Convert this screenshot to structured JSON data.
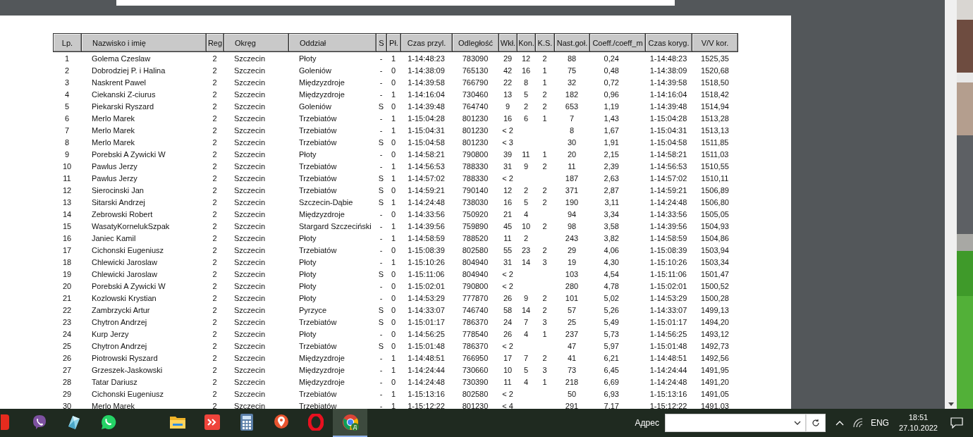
{
  "table": {
    "columns": [
      "Lp.",
      "Nazwisko i imię",
      "Reg",
      "Okręg",
      "Oddział",
      "S",
      "Pł.",
      "Czas przyl.",
      "Odległość",
      "Wkł.",
      "Kon.",
      "K.S.",
      "Nast.goł.",
      "Coeff./coeff_m",
      "Czas koryg.",
      "V/V kor."
    ],
    "rows": [
      [
        "1",
        "Golema Czeslaw",
        "2",
        "Szczecin",
        "Płoty",
        "-",
        "1",
        "1-14:48:23",
        "783090",
        "29",
        "12",
        "2",
        "88",
        "0,24",
        "1-14:48:23",
        "1525,35"
      ],
      [
        "2",
        "Dobrodziej P. i Halina",
        "2",
        "Szczecin",
        "Goleniów",
        "-",
        "0",
        "1-14:38:09",
        "765130",
        "42",
        "16",
        "1",
        "75",
        "0,48",
        "1-14:38:09",
        "1520,68"
      ],
      [
        "3",
        "Naskrent Pawel",
        "2",
        "Szczecin",
        "Międzyzdroje",
        "-",
        "0",
        "1-14:39:58",
        "766790",
        "22",
        "8",
        "1",
        "32",
        "0,72",
        "1-14:39:58",
        "1518,50"
      ],
      [
        "4",
        "Ciekanski Z-ciurus",
        "2",
        "Szczecin",
        "Międzyzdroje",
        "-",
        "1",
        "1-14:16:04",
        "730460",
        "13",
        "5",
        "2",
        "182",
        "0,96",
        "1-14:16:04",
        "1518,42"
      ],
      [
        "5",
        "Piekarski Ryszard",
        "2",
        "Szczecin",
        "Goleniów",
        "S",
        "0",
        "1-14:39:48",
        "764740",
        "9",
        "2",
        "2",
        "653",
        "1,19",
        "1-14:39:48",
        "1514,94"
      ],
      [
        "6",
        "Merlo Marek",
        "2",
        "Szczecin",
        "Trzebiatów",
        "-",
        "1",
        "1-15:04:28",
        "801230",
        "16",
        "6",
        "1",
        "7",
        "1,43",
        "1-15:04:28",
        "1513,28"
      ],
      [
        "7",
        "Merlo Marek",
        "2",
        "Szczecin",
        "Trzebiatów",
        "-",
        "1",
        "1-15:04:31",
        "801230",
        "< 2",
        null,
        null,
        "8",
        "1,67",
        "1-15:04:31",
        "1513,13"
      ],
      [
        "8",
        "Merlo Marek",
        "2",
        "Szczecin",
        "Trzebiatów",
        "S",
        "0",
        "1-15:04:58",
        "801230",
        "< 3",
        null,
        null,
        "30",
        "1,91",
        "1-15:04:58",
        "1511,85"
      ],
      [
        "9",
        "Porebski A Zywicki W",
        "2",
        "Szczecin",
        "Płoty",
        "-",
        "0",
        "1-14:58:21",
        "790800",
        "39",
        "11",
        "1",
        "20",
        "2,15",
        "1-14:58:21",
        "1511,03"
      ],
      [
        "10",
        "Pawlus Jerzy",
        "2",
        "Szczecin",
        "Trzebiatów",
        "-",
        "1",
        "1-14:56:53",
        "788330",
        "31",
        "9",
        "2",
        "11",
        "2,39",
        "1-14:56:53",
        "1510,55"
      ],
      [
        "11",
        "Pawlus Jerzy",
        "2",
        "Szczecin",
        "Trzebiatów",
        "S",
        "1",
        "1-14:57:02",
        "788330",
        "< 2",
        null,
        null,
        "187",
        "2,63",
        "1-14:57:02",
        "1510,11"
      ],
      [
        "12",
        "Sierocinski Jan",
        "2",
        "Szczecin",
        "Trzebiatów",
        "S",
        "0",
        "1-14:59:21",
        "790140",
        "12",
        "2",
        "2",
        "371",
        "2,87",
        "1-14:59:21",
        "1506,89"
      ],
      [
        "13",
        "Sitarski Andrzej",
        "2",
        "Szczecin",
        "Szczecin-Dąbie",
        "S",
        "1",
        "1-14:24:48",
        "738030",
        "16",
        "5",
        "2",
        "190",
        "3,11",
        "1-14:24:48",
        "1506,80"
      ],
      [
        "14",
        "Zebrowski Robert",
        "2",
        "Szczecin",
        "Międzyzdroje",
        "-",
        "0",
        "1-14:33:56",
        "750920",
        "21",
        "4",
        null,
        "94",
        "3,34",
        "1-14:33:56",
        "1505,05"
      ],
      [
        "15",
        "WasatyKornelukSzpak",
        "2",
        "Szczecin",
        "Stargard Szczeciński",
        "-",
        "1",
        "1-14:39:56",
        "759890",
        "45",
        "10",
        "2",
        "98",
        "3,58",
        "1-14:39:56",
        "1504,93"
      ],
      [
        "16",
        "Janiec Kamil",
        "2",
        "Szczecin",
        "Płoty",
        "-",
        "1",
        "1-14:58:59",
        "788520",
        "11",
        "2",
        null,
        "243",
        "3,82",
        "1-14:58:59",
        "1504,86"
      ],
      [
        "17",
        "Cichonski Eugeniusz",
        "2",
        "Szczecin",
        "Trzebiatów",
        "-",
        "0",
        "1-15:08:39",
        "802580",
        "55",
        "23",
        "2",
        "29",
        "4,06",
        "1-15:08:39",
        "1503,94"
      ],
      [
        "18",
        "Chlewicki Jaroslaw",
        "2",
        "Szczecin",
        "Płoty",
        "-",
        "1",
        "1-15:10:26",
        "804940",
        "31",
        "14",
        "3",
        "19",
        "4,30",
        "1-15:10:26",
        "1503,34"
      ],
      [
        "19",
        "Chlewicki Jaroslaw",
        "2",
        "Szczecin",
        "Płoty",
        "S",
        "0",
        "1-15:11:06",
        "804940",
        "< 2",
        null,
        null,
        "103",
        "4,54",
        "1-15:11:06",
        "1501,47"
      ],
      [
        "20",
        "Porebski A Zywicki W",
        "2",
        "Szczecin",
        "Płoty",
        "-",
        "0",
        "1-15:02:01",
        "790800",
        "< 2",
        null,
        null,
        "280",
        "4,78",
        "1-15:02:01",
        "1500,52"
      ],
      [
        "21",
        "Kozlowski Krystian",
        "2",
        "Szczecin",
        "Płoty",
        "-",
        "0",
        "1-14:53:29",
        "777870",
        "26",
        "9",
        "2",
        "101",
        "5,02",
        "1-14:53:29",
        "1500,28"
      ],
      [
        "22",
        "Zambrzycki Artur",
        "2",
        "Szczecin",
        "Pyrzyce",
        "S",
        "0",
        "1-14:33:07",
        "746740",
        "58",
        "14",
        "2",
        "57",
        "5,26",
        "1-14:33:07",
        "1499,13"
      ],
      [
        "23",
        "Chytron Andrzej",
        "2",
        "Szczecin",
        "Trzebiatów",
        "S",
        "0",
        "1-15:01:17",
        "786370",
        "24",
        "7",
        "3",
        "25",
        "5,49",
        "1-15:01:17",
        "1494,20"
      ],
      [
        "24",
        "Kurp Jerzy",
        "2",
        "Szczecin",
        "Płoty",
        "-",
        "0",
        "1-14:56:25",
        "778540",
        "26",
        "4",
        "1",
        "237",
        "5,73",
        "1-14:56:25",
        "1493,12"
      ],
      [
        "25",
        "Chytron Andrzej",
        "2",
        "Szczecin",
        "Trzebiatów",
        "S",
        "0",
        "1-15:01:48",
        "786370",
        "< 2",
        null,
        null,
        "47",
        "5,97",
        "1-15:01:48",
        "1492,73"
      ],
      [
        "26",
        "Piotrowski Ryszard",
        "2",
        "Szczecin",
        "Międzyzdroje",
        "-",
        "1",
        "1-14:48:51",
        "766950",
        "17",
        "7",
        "2",
        "41",
        "6,21",
        "1-14:48:51",
        "1492,56"
      ],
      [
        "27",
        "Grzeszek-Jaskowski",
        "2",
        "Szczecin",
        "Międzyzdroje",
        "-",
        "1",
        "1-14:24:44",
        "730660",
        "10",
        "5",
        "3",
        "73",
        "6,45",
        "1-14:24:44",
        "1491,95"
      ],
      [
        "28",
        "Tatar Dariusz",
        "2",
        "Szczecin",
        "Międzyzdroje",
        "-",
        "0",
        "1-14:24:48",
        "730390",
        "11",
        "4",
        "1",
        "218",
        "6,69",
        "1-14:24:48",
        "1491,20"
      ],
      [
        "29",
        "Cichonski Eugeniusz",
        "2",
        "Szczecin",
        "Trzebiatów",
        "-",
        "1",
        "1-15:13:16",
        "802580",
        "< 2",
        null,
        null,
        "50",
        "6,93",
        "1-15:13:16",
        "1491,05"
      ],
      [
        "30",
        "Merlo Marek",
        "2",
        "Szczecin",
        "Trzebiatów",
        "-",
        "1",
        "1-15:12:22",
        "801230",
        "< 4",
        null,
        null,
        "291",
        "7,17",
        "1-15:12:22",
        "1491,03"
      ]
    ]
  },
  "taskbar": {
    "launchers": [
      {
        "kind": "letter-tile",
        "selected": false
      },
      {
        "kind": "viber",
        "selected": false
      },
      {
        "kind": "crystal",
        "selected": false
      },
      {
        "kind": "whatsapp",
        "selected": false
      }
    ],
    "apps": [
      {
        "kind": "folder",
        "selected": false
      },
      {
        "kind": "remote",
        "selected": false
      },
      {
        "kind": "calculator",
        "selected": false
      },
      {
        "kind": "pin",
        "selected": false
      },
      {
        "kind": "opera",
        "selected": false
      },
      {
        "kind": "chrome",
        "selected": true,
        "badge": "Д"
      }
    ],
    "address": {
      "label": "Адрес"
    },
    "language": "ENG",
    "time": "18:51",
    "date": "27.10.2022"
  }
}
